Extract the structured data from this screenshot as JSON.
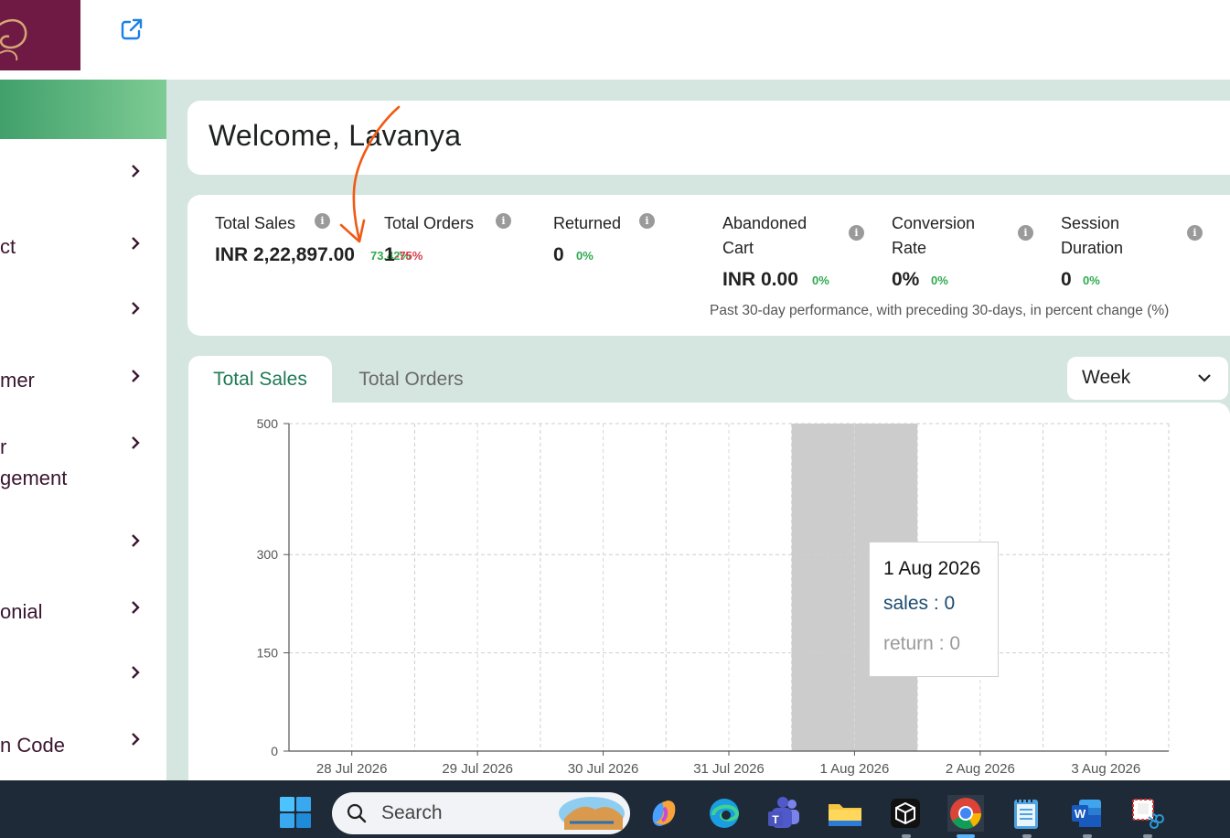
{
  "header": {
    "external_link_icon": "external-link-icon",
    "logo": "brand-logo"
  },
  "sidebar": {
    "items": [
      {
        "label": "",
        "top": 0
      },
      {
        "label": "ct"
      },
      {
        "label": ""
      },
      {
        "label": "mer"
      },
      {
        "label": "r\ngement"
      },
      {
        "label": ""
      },
      {
        "label": "onial"
      },
      {
        "label": ""
      },
      {
        "label": "n Code"
      }
    ]
  },
  "welcome": {
    "title": "Welcome, Lavanya"
  },
  "stats": {
    "total_sales": {
      "label": "Total Sales",
      "value": "INR 2,22,897.00",
      "change": "73.42%"
    },
    "total_orders": {
      "label": "Total Orders",
      "value": "1",
      "change": "-75%"
    },
    "returned": {
      "label": "Returned",
      "value": "0",
      "change": "0%"
    },
    "abandoned_cart": {
      "label": "Abandoned\nCart",
      "value": "INR 0.00",
      "change": "0%"
    },
    "conversion_rate": {
      "label": "Conversion\nRate",
      "value": "0%",
      "change": "0%"
    },
    "session_duration": {
      "label": "Session\nDuration",
      "value": "0",
      "change": "0%"
    },
    "info_glyph": "i",
    "note": "Past 30-day performance, with preceding 30-days, in percent change (%)"
  },
  "tabs": {
    "total_sales": "Total Sales",
    "total_orders": "Total Orders"
  },
  "period_select": {
    "value": "Week"
  },
  "chart_data": {
    "type": "bar",
    "categories": [
      "28 Jul 2026",
      "29 Jul 2026",
      "30 Jul 2026",
      "31 Jul 2026",
      "1 Aug 2026",
      "2 Aug 2026",
      "3 Aug 2026"
    ],
    "series": [
      {
        "values": [
          0,
          0,
          0,
          0,
          0,
          0,
          0
        ]
      }
    ],
    "y_ticks": [
      "0",
      "150",
      "300",
      "500"
    ],
    "y_tick_values": [
      0,
      150,
      300,
      500
    ],
    "ylim": [
      0,
      500
    ],
    "grid": true,
    "highlighted_category": "1 Aug 2026",
    "highlight_color": "#cccccc",
    "title": "",
    "xlabel": "",
    "ylabel": ""
  },
  "tooltip": {
    "date": "1 Aug 2026",
    "sales": "sales : 0",
    "return": "return : 0"
  },
  "taskbar": {
    "search_label": "Search",
    "apps": [
      "copilot-icon",
      "edge-icon",
      "teams-icon",
      "file-explorer-icon",
      "app-icon",
      "chrome-icon",
      "notepad-icon",
      "word-icon",
      "snipping-tool-icon"
    ]
  },
  "colors": {
    "brand": "#6e1a45",
    "accent_green": "#1e7a55",
    "positive": "#2eaa4f",
    "negative": "#d23f4b",
    "main_bg": "#d5e5df",
    "taskbar": "#1e2a38",
    "annotation": "#f05a14"
  }
}
